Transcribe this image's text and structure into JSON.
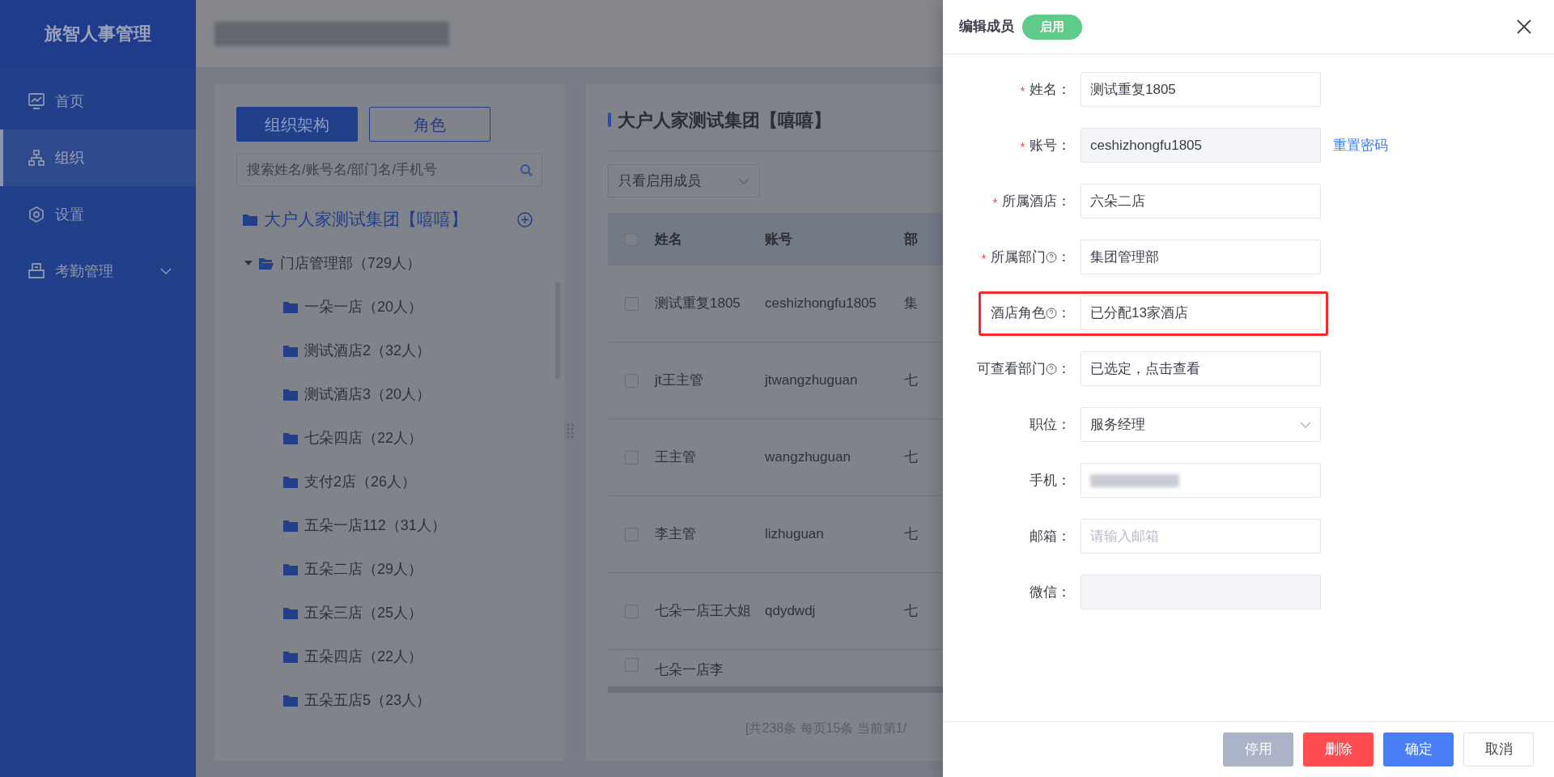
{
  "sidebar": {
    "title": "旅智人事管理",
    "items": [
      {
        "label": "首页",
        "selected": false,
        "expandable": false
      },
      {
        "label": "组织",
        "selected": true,
        "expandable": false
      },
      {
        "label": "设置",
        "selected": false,
        "expandable": false
      },
      {
        "label": "考勤管理",
        "selected": false,
        "expandable": true
      }
    ]
  },
  "org_panel": {
    "tabs": [
      {
        "label": "组织架构",
        "selected": true
      },
      {
        "label": "角色",
        "selected": false
      }
    ],
    "search": {
      "placeholder": "搜索姓名/账号名/部门名/手机号"
    },
    "tree": [
      {
        "label": "大户人家测试集团【嘻嘻】",
        "children": [
          {
            "label": "门店管理部（729人）",
            "expanded": true,
            "children": [
              {
                "label": "一朵一店（20人）"
              },
              {
                "label": "测试酒店2（32人）"
              },
              {
                "label": "测试酒店3（20人）"
              },
              {
                "label": "七朵四店（22人）"
              },
              {
                "label": "支付2店（26人）"
              },
              {
                "label": "五朵一店112（31人）"
              },
              {
                "label": "五朵二店（29人）"
              },
              {
                "label": "五朵三店（25人）"
              },
              {
                "label": "五朵四店（22人）"
              },
              {
                "label": "五朵五店5（23人）"
              }
            ]
          }
        ]
      }
    ]
  },
  "member_table": {
    "title": "大户人家测试集团【嘻嘻】",
    "filter": "只看启用成员",
    "all_checked": false,
    "columns": [
      "姓名",
      "账号",
      "部"
    ],
    "rows": [
      {
        "name": "测试重复1805",
        "account": "ceshizhongfu1805",
        "column_3": "集",
        "checked": false
      },
      {
        "name": "jt王主管",
        "account": "jtwangzhuguan",
        "column_3": "七",
        "checked": false
      },
      {
        "name": "王主管",
        "account": "wangzhuguan",
        "column_3": "七",
        "checked": false
      },
      {
        "name": "李主管",
        "account": "lizhuguan",
        "column_3": "七",
        "checked": false
      },
      {
        "name": "七朵一店王大姐",
        "account": "qdydwdj",
        "column_3": "七",
        "checked": false
      },
      {
        "name": "七朵一店李",
        "checked": false
      }
    ],
    "pagination": "[共238条 每页15条 当前第1/"
  },
  "drawer": {
    "title": "编辑成员",
    "status": {
      "label": "启用",
      "on": true
    },
    "fields": [
      {
        "label": "姓名",
        "colon": "：",
        "required": true,
        "help": false,
        "kind": "input",
        "value": "测试重复1805",
        "highlighted": false
      },
      {
        "label": "账号",
        "colon": "：",
        "required": true,
        "help": false,
        "kind": "readonly",
        "value": "ceshizhongfu1805",
        "link": "重置密码",
        "highlighted": false
      },
      {
        "label": "所属酒店",
        "colon": "：",
        "required": true,
        "help": false,
        "kind": "input",
        "value": "六朵二店",
        "highlighted": false
      },
      {
        "label": "所属部门",
        "colon": "：",
        "required": true,
        "help": true,
        "kind": "input",
        "value": "集团管理部",
        "highlighted": false
      },
      {
        "label": "酒店角色",
        "colon": "：",
        "required": false,
        "help": true,
        "kind": "input",
        "value": "已分配13家酒店",
        "highlighted": true
      },
      {
        "label": "可查看部门",
        "colon": "：",
        "required": false,
        "help": true,
        "kind": "input",
        "value": "已选定，点击查看",
        "highlighted": false
      },
      {
        "label": "职位",
        "colon": "：",
        "required": false,
        "help": false,
        "kind": "select",
        "value": "服务经理",
        "highlighted": false
      },
      {
        "label": "手机",
        "colon": "：",
        "required": false,
        "help": false,
        "kind": "masked",
        "highlighted": false
      },
      {
        "label": "邮箱",
        "colon": "：",
        "required": false,
        "help": false,
        "kind": "input",
        "placeholder": "请输入邮箱",
        "highlighted": false
      },
      {
        "label": "微信",
        "colon": "：",
        "required": false,
        "help": false,
        "kind": "readonly",
        "highlighted": false
      }
    ],
    "buttons": [
      {
        "label": "停用",
        "kind": "muted"
      },
      {
        "label": "删除",
        "kind": "danger"
      },
      {
        "label": "确定",
        "kind": "primary"
      },
      {
        "label": "取消",
        "kind": "default"
      }
    ]
  }
}
